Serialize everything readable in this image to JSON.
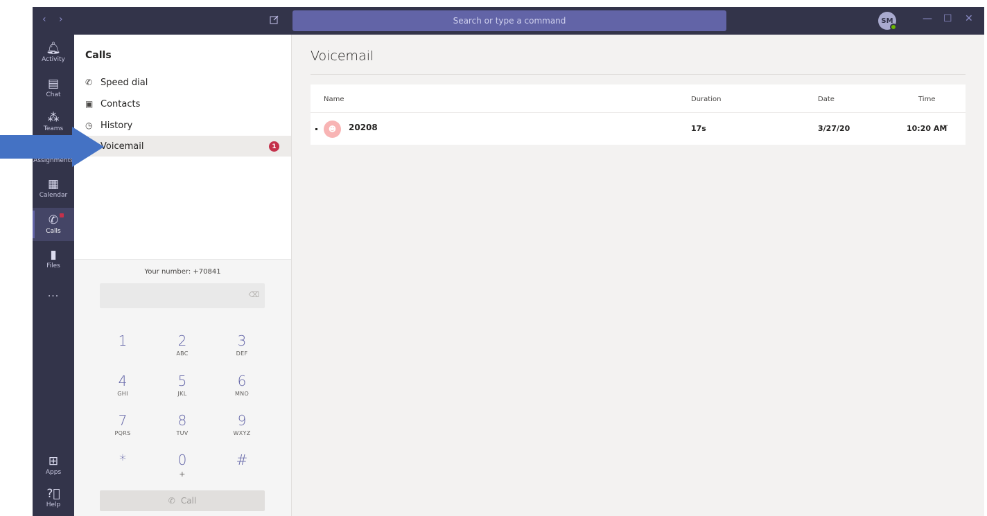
{
  "titlebar": {
    "back": "‹",
    "forward": "›",
    "compose_icon": "compose-icon",
    "search_placeholder": "Search or type a command",
    "avatar_initials": "SM",
    "minimize": "—",
    "maximize": "☐",
    "close": "✕"
  },
  "appbar": [
    {
      "label": "Activity",
      "icon": "bell-icon"
    },
    {
      "label": "Chat",
      "icon": "chat-icon"
    },
    {
      "label": "Teams",
      "icon": "teams-icon"
    },
    {
      "label": "Assignments",
      "icon": "assignments-icon"
    },
    {
      "label": "Calendar",
      "icon": "calendar-icon"
    },
    {
      "label": "Calls",
      "icon": "phone-icon"
    },
    {
      "label": "Files",
      "icon": "file-icon"
    },
    {
      "label": "...",
      "icon": "more-icon"
    },
    {
      "label": "Apps",
      "icon": "apps-icon"
    },
    {
      "label": "Help",
      "icon": "help-icon"
    }
  ],
  "calls": {
    "title": "Calls",
    "menu": [
      {
        "label": "Speed dial",
        "icon": "phone-icon"
      },
      {
        "label": "Contacts",
        "icon": "contacts-icon"
      },
      {
        "label": "History",
        "icon": "clock-icon"
      },
      {
        "label": "Voicemail",
        "icon": "voicemail-icon",
        "badge": "1"
      }
    ],
    "your_number": "Your number: +70841",
    "keypad": [
      {
        "num": "1",
        "sub": ""
      },
      {
        "num": "2",
        "sub": "ABC"
      },
      {
        "num": "3",
        "sub": "DEF"
      },
      {
        "num": "4",
        "sub": "GHI"
      },
      {
        "num": "5",
        "sub": "JKL"
      },
      {
        "num": "6",
        "sub": "MNO"
      },
      {
        "num": "7",
        "sub": "PQRS"
      },
      {
        "num": "8",
        "sub": "TUV"
      },
      {
        "num": "9",
        "sub": "WXYZ"
      },
      {
        "num": "*",
        "sub": ""
      },
      {
        "num": "0",
        "sub": "+"
      },
      {
        "num": "#",
        "sub": ""
      }
    ],
    "call_label": "Call"
  },
  "voicemail": {
    "title": "Voicemail",
    "columns": {
      "name": "Name",
      "duration": "Duration",
      "date": "Date",
      "time": "Time"
    },
    "rows": [
      {
        "name": "20208",
        "duration": "17s",
        "date": "3/27/20",
        "time": "10:20 AM",
        "more": "···"
      }
    ]
  },
  "colors": {
    "accent": "#6264a7",
    "titlebar": "#33344a",
    "badge": "#c4314b",
    "overlay_arrow": "#4472c4"
  }
}
